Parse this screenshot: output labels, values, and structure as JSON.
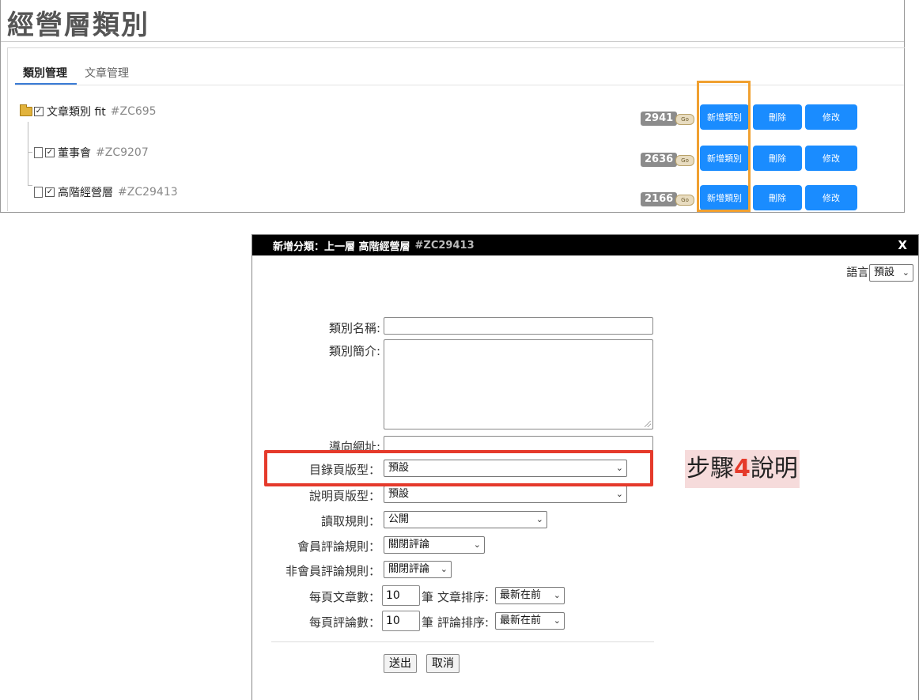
{
  "page": {
    "title": "經營層類別"
  },
  "tabs": [
    {
      "label": "類別管理"
    },
    {
      "label": "文章管理"
    }
  ],
  "tree": [
    {
      "name": "文章類別 fit",
      "code": "#ZC695",
      "count": "2941"
    },
    {
      "name": "董事會",
      "code": "#ZC9207",
      "count": "2636"
    },
    {
      "name": "高階經營層",
      "code": "#ZC29413",
      "count": "2166"
    }
  ],
  "row_actions": {
    "view_icon": "Go",
    "add": "新增類別",
    "delete": "刪除",
    "edit": "修改"
  },
  "dialog": {
    "title": "新增分類：上一層 高階經營層",
    "code": "#ZC29413",
    "close": "X",
    "language_label": "語言:",
    "language_value": "預設",
    "fields": {
      "name_label": "類別名稱:",
      "intro_label": "類別簡介:",
      "redirect_label": "導向網址:",
      "list_template_label": "目錄頁版型：",
      "list_template_value": "預設",
      "desc_template_label": "說明頁版型：",
      "desc_template_value": "預設",
      "read_rule_label": "讀取規則：",
      "read_rule_value": "公開",
      "member_comment_label": "會員評論規則：",
      "member_comment_value": "關閉評論",
      "guest_comment_label": "非會員評論規則：",
      "guest_comment_value": "關閉評論",
      "articles_per_page_label": "每頁文章數：",
      "articles_per_page_value": "10",
      "articles_unit": "筆",
      "article_sort_label": "文章排序:",
      "article_sort_value": "最新在前",
      "comments_per_page_label": "每頁評論數：",
      "comments_per_page_value": "10",
      "comments_unit": "筆",
      "comment_sort_label": "評論排序:",
      "comment_sort_value": "最新在前"
    },
    "submit": "送出",
    "cancel": "取消"
  },
  "annotation": {
    "prefix": "步驟",
    "number": "4",
    "suffix": "說明"
  },
  "colors": {
    "button_blue": "#1a8cff",
    "highlight_orange": "#f0a030",
    "highlight_red": "#e53a2b",
    "note_bg": "#f6dbdb"
  }
}
